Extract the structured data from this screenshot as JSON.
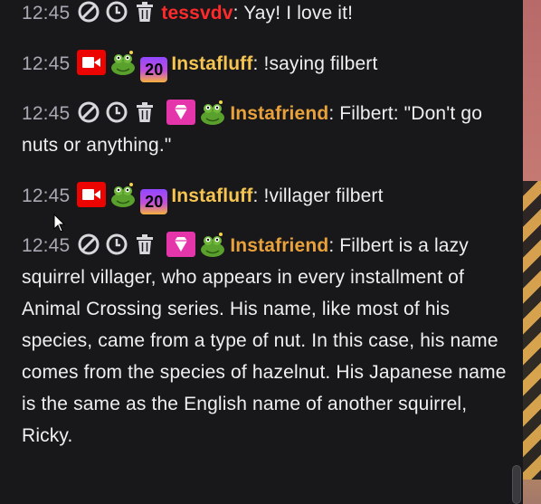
{
  "colors": {
    "background": "#18181b",
    "timestamp": "#a8a8b3",
    "user_tessvdv": "#ff2a2a",
    "user_instafluff": "#f5c451",
    "user_instafriend": "#e9a23b"
  },
  "icons": {
    "mod_actions": [
      "ban-icon",
      "timeout-clock-icon",
      "delete-trash-icon"
    ],
    "badges": [
      "broadcaster-camera-badge",
      "gem-badge",
      "sub-20-badge"
    ],
    "emote": "green-frog-emote"
  },
  "messages": [
    {
      "time": "12:45",
      "user": "tessvdv",
      "sep": ": ",
      "text": "Yay! I love it!"
    },
    {
      "time": "12:45",
      "badge_text": "20",
      "user": "Instafluff",
      "sep": ": ",
      "text": "!saying filbert"
    },
    {
      "time": "12:45",
      "user": "Instafriend",
      "sep": ": ",
      "text": "Filbert: \"Don't go nuts or anything.\""
    },
    {
      "time": "12:45",
      "badge_text": "20",
      "user": "Instafluff",
      "sep": ": ",
      "text": "!villager filbert"
    },
    {
      "time": "12:45",
      "user": "Instafriend",
      "sep": ": ",
      "text": "Filbert is a lazy squirrel villager, who appears in every installment of Animal Crossing series. His name, like most of his species, came from a type of nut. In this case, his name comes from the species of hazelnut. His Japanese name is the same as the English name of another squirrel, Ricky."
    }
  ]
}
